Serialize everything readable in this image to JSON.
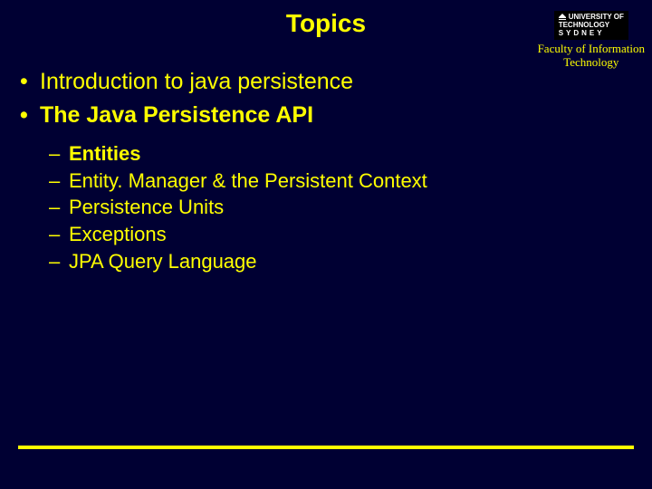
{
  "title": "Topics",
  "logo": {
    "line1": "UNIVERSITY OF",
    "line2": "TECHNOLOGY",
    "line3": "SYDNEY"
  },
  "faculty": {
    "line1": "Faculty of Information",
    "line2": "Technology"
  },
  "bullets": {
    "b1": "Introduction to java persistence",
    "b2": "The Java Persistence API"
  },
  "sub": {
    "s1": "Entities",
    "s2": "Entity. Manager & the Persistent Context",
    "s3": "Persistence Units",
    "s4": "Exceptions",
    "s5": "JPA Query Language"
  }
}
